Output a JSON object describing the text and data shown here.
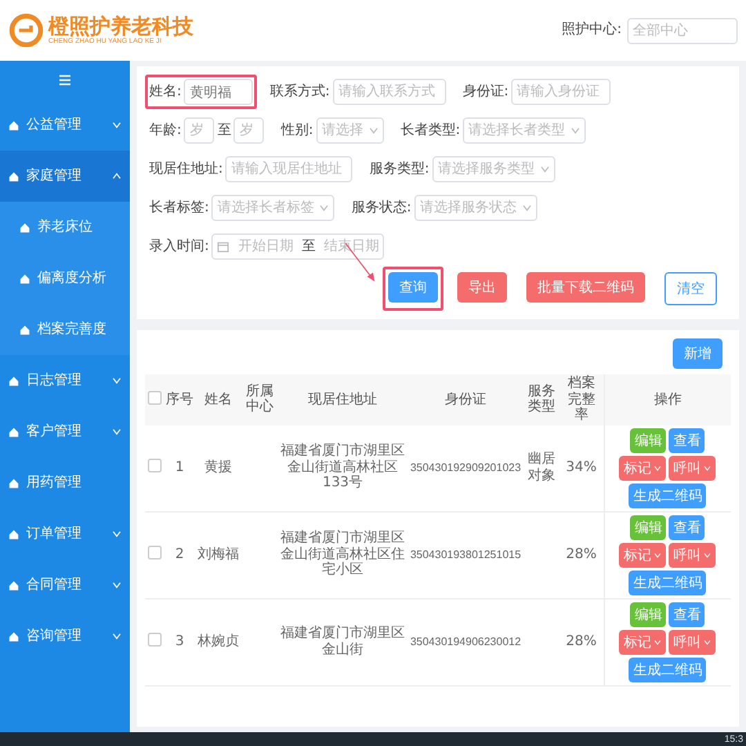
{
  "header": {
    "logo_title": "橙照护养老科技",
    "logo_subtitle": "CHENG ZHAO HU YANG LAO KE JI",
    "center_label": "照护中心:",
    "center_placeholder": "全部中心"
  },
  "sidebar": {
    "items": [
      {
        "label": "公益管理",
        "kind": "group",
        "expanded": false
      },
      {
        "label": "家庭管理",
        "kind": "group",
        "expanded": true,
        "children": [
          {
            "label": "养老床位"
          },
          {
            "label": "偏离度分析"
          },
          {
            "label": "档案完善度"
          }
        ]
      },
      {
        "label": "日志管理",
        "kind": "group",
        "expanded": false
      },
      {
        "label": "客户管理",
        "kind": "group",
        "expanded": false
      },
      {
        "label": "用药管理",
        "kind": "link"
      },
      {
        "label": "订单管理",
        "kind": "group",
        "expanded": false
      },
      {
        "label": "合同管理",
        "kind": "group",
        "expanded": false
      },
      {
        "label": "咨询管理",
        "kind": "group",
        "expanded": false
      }
    ]
  },
  "filters": [
    [
      {
        "kind": "text",
        "label": "姓名:",
        "value": "黄明福",
        "highlighted": true
      },
      {
        "kind": "text",
        "label": "联系方式:",
        "placeholder": "请输入联系方式",
        "highlighted": false
      },
      {
        "kind": "text",
        "label": "身份证:",
        "placeholder": "请输入身份证",
        "highlighted": false
      },
      {
        "kind": "range",
        "label": "年龄:",
        "from_placeholder": "岁",
        "separator": "至",
        "to_placeholder": "岁",
        "highlighted": false
      }
    ],
    [
      {
        "kind": "select",
        "label": "性别:",
        "placeholder": "请选择",
        "highlighted": false
      },
      {
        "kind": "select",
        "label": "长者类型:",
        "placeholder": "请选择长者类型",
        "highlighted": false
      },
      {
        "kind": "text",
        "label": "现居住地址:",
        "placeholder": "请输入现居住地址",
        "highlighted": false
      },
      {
        "kind": "select",
        "label": "服务类型:",
        "placeholder": "请选择服务类型",
        "highlighted": false
      }
    ],
    [
      {
        "kind": "select",
        "label": "长者标签:",
        "placeholder": "请选择长者标签",
        "highlighted": false
      },
      {
        "kind": "select",
        "label": "服务状态:",
        "placeholder": "请选择服务状态",
        "highlighted": false
      },
      {
        "kind": "date_range",
        "label": "录入时间:",
        "from_placeholder": "开始日期",
        "separator": "至",
        "to_placeholder": "结束日期",
        "highlighted": false
      }
    ]
  ],
  "actions": [
    {
      "label": "查询",
      "kind": "primary",
      "highlighted": true
    },
    {
      "label": "导出",
      "kind": "danger",
      "highlighted": false
    },
    {
      "label": "批量下载二维码",
      "kind": "danger",
      "highlighted": false
    },
    {
      "label": "清空",
      "kind": "plain",
      "highlighted": false
    }
  ],
  "add_button": "新增",
  "table": {
    "all_checked": false,
    "columns": [
      "序号",
      "姓名",
      "所属中心",
      "现居住地址",
      "身份证",
      "服务类型",
      "档案完整率",
      "操作"
    ],
    "rows": [
      {
        "checked": false,
        "cells": [
          "1",
          "黄援",
          "",
          "福建省厦门市湖里区金山街道高林社区133号",
          "350430192909201023",
          "幽居对象",
          "34%"
        ],
        "actions": [
          {
            "label": "编辑",
            "kind": "success",
            "dropdown": false
          },
          {
            "label": "查看",
            "kind": "primary",
            "dropdown": false
          },
          {
            "label": "标记",
            "kind": "danger",
            "dropdown": true
          },
          {
            "label": "呼叫",
            "kind": "danger",
            "dropdown": true
          },
          {
            "label": "生成二维码",
            "kind": "primary",
            "dropdown": false
          }
        ]
      },
      {
        "checked": false,
        "cells": [
          "2",
          "刘梅福",
          "",
          "福建省厦门市湖里区金山街道高林社区住宅小区",
          "350430193801251015",
          "",
          "28%"
        ],
        "actions": [
          {
            "label": "编辑",
            "kind": "success",
            "dropdown": false
          },
          {
            "label": "查看",
            "kind": "primary",
            "dropdown": false
          },
          {
            "label": "标记",
            "kind": "danger",
            "dropdown": true
          },
          {
            "label": "呼叫",
            "kind": "danger",
            "dropdown": true
          },
          {
            "label": "生成二维码",
            "kind": "primary",
            "dropdown": false
          }
        ]
      },
      {
        "checked": false,
        "cells": [
          "3",
          "林婉贞",
          "",
          "福建省厦门市湖里区金山街",
          "350430194906230012",
          "",
          "28%"
        ],
        "actions": [
          {
            "label": "编辑",
            "kind": "success",
            "dropdown": false
          },
          {
            "label": "查看",
            "kind": "primary",
            "dropdown": false
          },
          {
            "label": "标记",
            "kind": "danger",
            "dropdown": true
          },
          {
            "label": "呼叫",
            "kind": "danger",
            "dropdown": true
          },
          {
            "label": "生成二维码",
            "kind": "primary",
            "dropdown": false
          }
        ]
      }
    ]
  },
  "taskbar": {
    "clock": "15:3"
  }
}
